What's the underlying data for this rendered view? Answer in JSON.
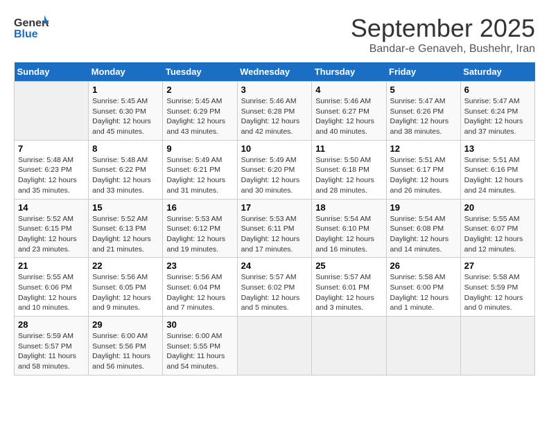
{
  "header": {
    "logo_line1": "General",
    "logo_line2": "Blue",
    "month": "September 2025",
    "location": "Bandar-e Genaveh, Bushehr, Iran"
  },
  "weekdays": [
    "Sunday",
    "Monday",
    "Tuesday",
    "Wednesday",
    "Thursday",
    "Friday",
    "Saturday"
  ],
  "weeks": [
    [
      {
        "day": "",
        "info": ""
      },
      {
        "day": "1",
        "info": "Sunrise: 5:45 AM\nSunset: 6:30 PM\nDaylight: 12 hours\nand 45 minutes."
      },
      {
        "day": "2",
        "info": "Sunrise: 5:45 AM\nSunset: 6:29 PM\nDaylight: 12 hours\nand 43 minutes."
      },
      {
        "day": "3",
        "info": "Sunrise: 5:46 AM\nSunset: 6:28 PM\nDaylight: 12 hours\nand 42 minutes."
      },
      {
        "day": "4",
        "info": "Sunrise: 5:46 AM\nSunset: 6:27 PM\nDaylight: 12 hours\nand 40 minutes."
      },
      {
        "day": "5",
        "info": "Sunrise: 5:47 AM\nSunset: 6:26 PM\nDaylight: 12 hours\nand 38 minutes."
      },
      {
        "day": "6",
        "info": "Sunrise: 5:47 AM\nSunset: 6:24 PM\nDaylight: 12 hours\nand 37 minutes."
      }
    ],
    [
      {
        "day": "7",
        "info": "Sunrise: 5:48 AM\nSunset: 6:23 PM\nDaylight: 12 hours\nand 35 minutes."
      },
      {
        "day": "8",
        "info": "Sunrise: 5:48 AM\nSunset: 6:22 PM\nDaylight: 12 hours\nand 33 minutes."
      },
      {
        "day": "9",
        "info": "Sunrise: 5:49 AM\nSunset: 6:21 PM\nDaylight: 12 hours\nand 31 minutes."
      },
      {
        "day": "10",
        "info": "Sunrise: 5:49 AM\nSunset: 6:20 PM\nDaylight: 12 hours\nand 30 minutes."
      },
      {
        "day": "11",
        "info": "Sunrise: 5:50 AM\nSunset: 6:18 PM\nDaylight: 12 hours\nand 28 minutes."
      },
      {
        "day": "12",
        "info": "Sunrise: 5:51 AM\nSunset: 6:17 PM\nDaylight: 12 hours\nand 26 minutes."
      },
      {
        "day": "13",
        "info": "Sunrise: 5:51 AM\nSunset: 6:16 PM\nDaylight: 12 hours\nand 24 minutes."
      }
    ],
    [
      {
        "day": "14",
        "info": "Sunrise: 5:52 AM\nSunset: 6:15 PM\nDaylight: 12 hours\nand 23 minutes."
      },
      {
        "day": "15",
        "info": "Sunrise: 5:52 AM\nSunset: 6:13 PM\nDaylight: 12 hours\nand 21 minutes."
      },
      {
        "day": "16",
        "info": "Sunrise: 5:53 AM\nSunset: 6:12 PM\nDaylight: 12 hours\nand 19 minutes."
      },
      {
        "day": "17",
        "info": "Sunrise: 5:53 AM\nSunset: 6:11 PM\nDaylight: 12 hours\nand 17 minutes."
      },
      {
        "day": "18",
        "info": "Sunrise: 5:54 AM\nSunset: 6:10 PM\nDaylight: 12 hours\nand 16 minutes."
      },
      {
        "day": "19",
        "info": "Sunrise: 5:54 AM\nSunset: 6:08 PM\nDaylight: 12 hours\nand 14 minutes."
      },
      {
        "day": "20",
        "info": "Sunrise: 5:55 AM\nSunset: 6:07 PM\nDaylight: 12 hours\nand 12 minutes."
      }
    ],
    [
      {
        "day": "21",
        "info": "Sunrise: 5:55 AM\nSunset: 6:06 PM\nDaylight: 12 hours\nand 10 minutes."
      },
      {
        "day": "22",
        "info": "Sunrise: 5:56 AM\nSunset: 6:05 PM\nDaylight: 12 hours\nand 9 minutes."
      },
      {
        "day": "23",
        "info": "Sunrise: 5:56 AM\nSunset: 6:04 PM\nDaylight: 12 hours\nand 7 minutes."
      },
      {
        "day": "24",
        "info": "Sunrise: 5:57 AM\nSunset: 6:02 PM\nDaylight: 12 hours\nand 5 minutes."
      },
      {
        "day": "25",
        "info": "Sunrise: 5:57 AM\nSunset: 6:01 PM\nDaylight: 12 hours\nand 3 minutes."
      },
      {
        "day": "26",
        "info": "Sunrise: 5:58 AM\nSunset: 6:00 PM\nDaylight: 12 hours\nand 1 minute."
      },
      {
        "day": "27",
        "info": "Sunrise: 5:58 AM\nSunset: 5:59 PM\nDaylight: 12 hours\nand 0 minutes."
      }
    ],
    [
      {
        "day": "28",
        "info": "Sunrise: 5:59 AM\nSunset: 5:57 PM\nDaylight: 11 hours\nand 58 minutes."
      },
      {
        "day": "29",
        "info": "Sunrise: 6:00 AM\nSunset: 5:56 PM\nDaylight: 11 hours\nand 56 minutes."
      },
      {
        "day": "30",
        "info": "Sunrise: 6:00 AM\nSunset: 5:55 PM\nDaylight: 11 hours\nand 54 minutes."
      },
      {
        "day": "",
        "info": ""
      },
      {
        "day": "",
        "info": ""
      },
      {
        "day": "",
        "info": ""
      },
      {
        "day": "",
        "info": ""
      }
    ]
  ]
}
